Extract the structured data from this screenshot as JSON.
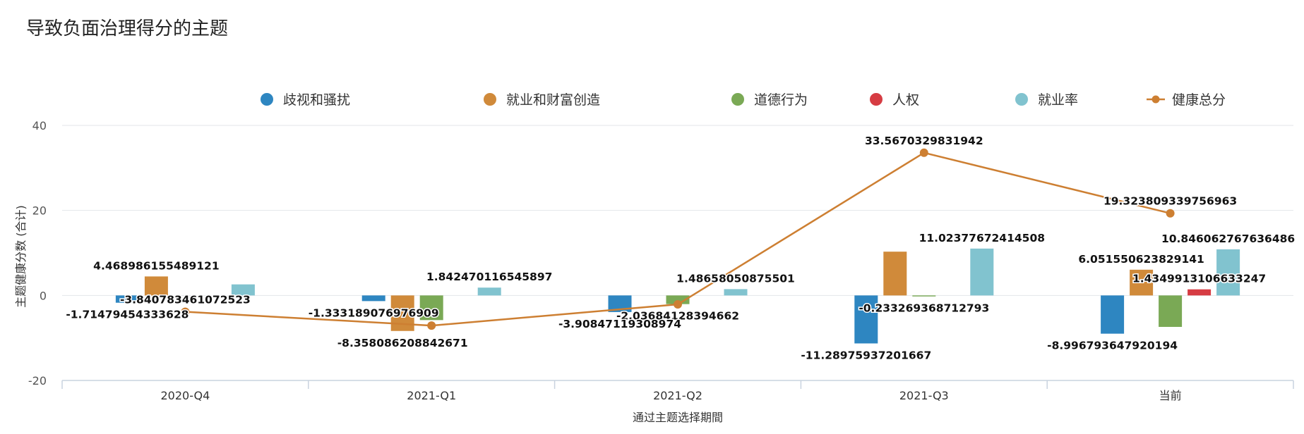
{
  "title": "导致负面治理得分的主题",
  "chart_data": {
    "type": "bar",
    "title": "导致负面治理得分的主题",
    "xlabel": "通过主题选择期間",
    "ylabel": "主题健康分数 (合计)",
    "ylim": [
      -20,
      40
    ],
    "yticks": [
      40,
      20,
      0,
      -20
    ],
    "grid": true,
    "legend_position": "top",
    "categories": [
      "2020-Q4",
      "2021-Q1",
      "2021-Q2",
      "2021-Q3",
      "当前"
    ],
    "series": [
      {
        "name": "歧视和骚扰",
        "type": "bar",
        "color": "#2e86c1",
        "values": [
          -1.71479454333628,
          -1.333189076976909,
          -3.90847119308974,
          -11.28975937201667,
          -8.996793647920194
        ]
      },
      {
        "name": "就业和财富创造",
        "type": "bar",
        "color": "#d08a3a",
        "values": [
          4.468986155489121,
          -8.358086208842671,
          null,
          10.3,
          6.051550623829141
        ]
      },
      {
        "name": "道德行为",
        "type": "bar",
        "color": "#7aa955",
        "values": [
          null,
          -5.8,
          -2.03684128394662,
          -0.233269368712793,
          -7.4
        ]
      },
      {
        "name": "人权",
        "type": "bar",
        "color": "#d63c43",
        "values": [
          null,
          null,
          null,
          null,
          1.4349913106633247
        ]
      },
      {
        "name": "就业率",
        "type": "bar",
        "color": "#81c3cf",
        "values": [
          2.6,
          1.842470116545897,
          1.48658050875501,
          11.02377672414508,
          10.846062767636486
        ]
      },
      {
        "name": "健康总分",
        "type": "line",
        "color": "#cd7f32",
        "values": [
          -3.840783461072523,
          -7.1,
          -2.1,
          33.5670329831942,
          19.323809339756963
        ]
      }
    ],
    "data_labels": [
      {
        "text": "4.468986155489121",
        "cat": 0,
        "series": 1
      },
      {
        "text": "-3.840783461072523",
        "cat": 0,
        "series": 5
      },
      {
        "text": "-1.71479454333628",
        "cat": 0,
        "series": 0
      },
      {
        "text": "1.842470116545897",
        "cat": 1,
        "series": 4
      },
      {
        "text": "-1.333189076976909",
        "cat": 1,
        "series": 0
      },
      {
        "text": "-8.358086208842671",
        "cat": 1,
        "series": 1
      },
      {
        "text": "-2.03684128394662",
        "cat": 2,
        "series": 2
      },
      {
        "text": "1.48658050875501",
        "cat": 2,
        "series": 4
      },
      {
        "text": "-3.90847119308974",
        "cat": 2,
        "series": 0
      },
      {
        "text": "33.5670329831942",
        "cat": 3,
        "series": 5
      },
      {
        "text": "11.02377672414508",
        "cat": 3,
        "series": 4
      },
      {
        "text": "-0.233269368712793",
        "cat": 3,
        "series": 2
      },
      {
        "text": "-11.28975937201667",
        "cat": 3,
        "series": 0
      },
      {
        "text": "19.323809339756963",
        "cat": 4,
        "series": 5
      },
      {
        "text": "6.051550623829141",
        "cat": 4,
        "series": 1
      },
      {
        "text": "10.846062767636486",
        "cat": 4,
        "series": 4
      },
      {
        "text": "1.4349913106633247",
        "cat": 4,
        "series": 3
      },
      {
        "text": "-8.996793647920194",
        "cat": 4,
        "series": 0
      }
    ]
  }
}
